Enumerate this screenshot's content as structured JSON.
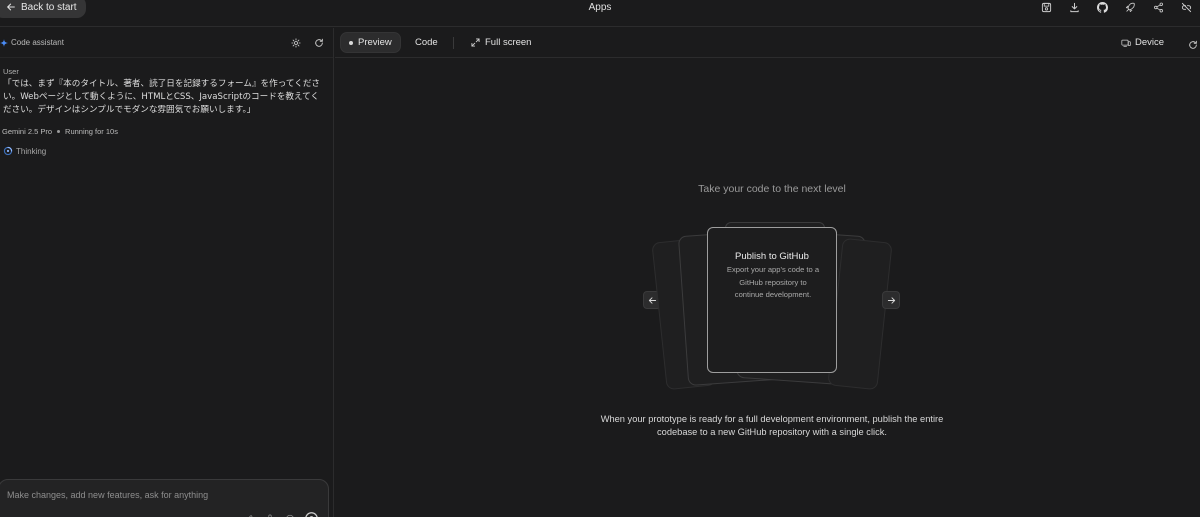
{
  "topbar": {
    "back_label": "Back to start",
    "app_title": "Apps",
    "actions": [
      "save-icon",
      "download-icon",
      "github-icon",
      "rocket-icon",
      "share-icon",
      "link-off-icon"
    ]
  },
  "left_panel": {
    "header_label": "Code assistant",
    "message": {
      "role": "User",
      "text": "「では、まず『本のタイトル、著者、読了日を記録するフォーム』を作ってください。Webページとして動くように、HTMLとCSS、JavaScriptのコードを教えてください。デザインはシンプルでモダンな雰囲気でお願いします。」"
    },
    "model": "Gemini 2.5 Pro",
    "run_status": "Running for 10s",
    "thinking_label": "Thinking",
    "composer_placeholder": "Make changes, add new features, ask for anything"
  },
  "right_panel": {
    "tabs": {
      "preview": "Preview",
      "code": "Code",
      "fullscreen": "Full screen"
    },
    "device_label": "Device",
    "promo": {
      "heading": "Take your code to the next level",
      "card_title": "Publish to GitHub",
      "card_desc": "Export your app's code to a GitHub repository to continue development.",
      "body": "When your prototype is ready for a full development environment, publish the entire codebase to a new GitHub repository with a single click."
    }
  },
  "colors": {
    "background": "#1b1b1c",
    "accent": "#4a8cf7"
  }
}
